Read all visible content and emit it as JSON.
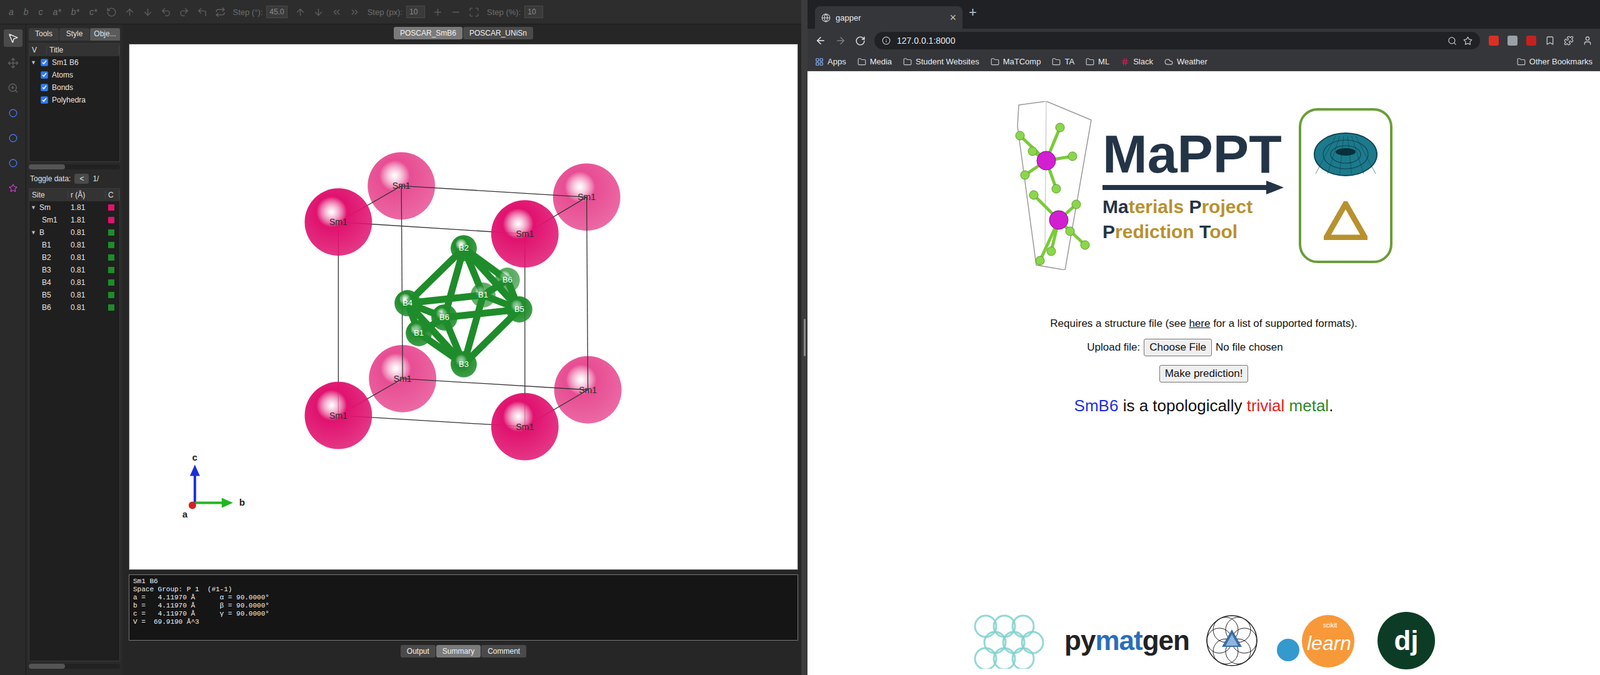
{
  "vesta": {
    "toolbar": {
      "axis_buttons": [
        "a",
        "b",
        "c",
        "a*",
        "b*",
        "c*"
      ],
      "fields": [
        {
          "label": "Step (°):",
          "value": "45.0"
        },
        {
          "label": "Step (px):",
          "value": "10"
        },
        {
          "label": "Step (%):",
          "value": "10"
        }
      ]
    },
    "side_tabs": [
      {
        "label": "Tools",
        "selected": false
      },
      {
        "label": "Style",
        "selected": false
      },
      {
        "label": "Obje...",
        "selected": true
      }
    ],
    "tree": {
      "columns": [
        "V",
        "Title"
      ],
      "items": [
        {
          "label": "Sm1 B6",
          "checked": true,
          "expanded": true,
          "toggle": "▼",
          "children": [
            {
              "label": "Atoms",
              "checked": true
            },
            {
              "label": "Bonds",
              "checked": true
            },
            {
              "label": "Polyhedra",
              "checked": true
            }
          ]
        }
      ]
    },
    "toggle": {
      "label": "Toggle data:",
      "prev": "<",
      "page": "1/"
    },
    "sites": {
      "columns": [
        "Site",
        "r (Å)",
        "C"
      ],
      "groups": [
        {
          "label": "Sm",
          "radius": "1.81",
          "color": "#e0126f",
          "expanded": true,
          "toggle": "▼",
          "rows": [
            {
              "label": "Sm1",
              "radius": "1.81",
              "color": "#e0126f"
            }
          ]
        },
        {
          "label": "B",
          "radius": "0.81",
          "color": "#1e8c2a",
          "expanded": true,
          "toggle": "▼",
          "rows": [
            {
              "label": "B1",
              "radius": "0.81",
              "color": "#1e8c2a"
            },
            {
              "label": "B2",
              "radius": "0.81",
              "color": "#1e8c2a"
            },
            {
              "label": "B3",
              "radius": "0.81",
              "color": "#1e8c2a"
            },
            {
              "label": "B4",
              "radius": "0.81",
              "color": "#1e8c2a"
            },
            {
              "label": "B5",
              "radius": "0.81",
              "color": "#1e8c2a"
            },
            {
              "label": "B6",
              "radius": "0.81",
              "color": "#1e8c2a"
            }
          ]
        }
      ]
    },
    "file_tabs": [
      {
        "label": "POSCAR_SmB6",
        "selected": true
      },
      {
        "label": "POSCAR_UNiSn",
        "selected": false
      }
    ],
    "structure": {
      "atoms": [
        {
          "label": "Sm1",
          "element": "Sm"
        },
        {
          "label": "Sm1",
          "element": "Sm"
        },
        {
          "label": "Sm1",
          "element": "Sm"
        },
        {
          "label": "Sm1",
          "element": "Sm"
        },
        {
          "label": "Sm1",
          "element": "Sm"
        },
        {
          "label": "Sm1",
          "element": "Sm"
        },
        {
          "label": "Sm1",
          "element": "Sm"
        },
        {
          "label": "Sm1",
          "element": "Sm"
        },
        {
          "label": "B6",
          "element": "B"
        },
        {
          "label": "B1",
          "element": "B"
        },
        {
          "label": "B2",
          "element": "B"
        },
        {
          "label": "B4",
          "element": "B"
        },
        {
          "label": "B5",
          "element": "B"
        },
        {
          "label": "B6",
          "element": "B"
        },
        {
          "label": "B1",
          "element": "B"
        },
        {
          "label": "B3",
          "element": "B"
        }
      ],
      "axes": [
        {
          "label": "a",
          "color": "#d62020"
        },
        {
          "label": "b",
          "color": "#22b522"
        },
        {
          "label": "c",
          "color": "#1b2fd6"
        }
      ]
    },
    "summary": [
      "Sm1 B6",
      "Space Group: P 1  (#1-1)",
      "a =   4.11970 Å      α = 90.0000°",
      "b =   4.11970 Å      β = 90.0000°",
      "c =   4.11970 Å      γ = 90.0000°",
      "V =  69.9190 Å^3"
    ],
    "output_tabs": [
      {
        "label": "Output",
        "selected": false
      },
      {
        "label": "Summary",
        "selected": true
      },
      {
        "label": "Comment",
        "selected": false
      }
    ]
  },
  "browser": {
    "tab": {
      "title": "gapper",
      "close": "×",
      "new": "+"
    },
    "url": "127.0.0.1:8000",
    "bookmarks": [
      {
        "label": "Apps",
        "kind": "apps"
      },
      {
        "label": "Media",
        "kind": "folder"
      },
      {
        "label": "Student Websites",
        "kind": "folder"
      },
      {
        "label": "MaTComp",
        "kind": "folder"
      },
      {
        "label": "TA",
        "kind": "folder"
      },
      {
        "label": "ML",
        "kind": "folder"
      },
      {
        "label": "Slack",
        "kind": "slack"
      },
      {
        "label": "Weather",
        "kind": "weather"
      }
    ],
    "other_bookmarks": "Other Bookmarks",
    "page": {
      "logo": {
        "title": "MaPPT",
        "subtitle": [
          [
            {
              "text": "Ma",
              "color": "#243447"
            },
            {
              "text": "terials ",
              "color": "#b8912f"
            },
            {
              "text": "P",
              "color": "#243447"
            },
            {
              "text": "roject",
              "color": "#b8912f"
            }
          ],
          [
            {
              "text": "P",
              "color": "#243447"
            },
            {
              "text": "rediction ",
              "color": "#b8912f"
            },
            {
              "text": "T",
              "color": "#243447"
            },
            {
              "text": "ool",
              "color": "#b8912f"
            }
          ]
        ]
      },
      "requires": {
        "before": "Requires a structure file (see ",
        "link": "here",
        "after": " for a list of supported formats)."
      },
      "upload": {
        "label": "Upload file:",
        "button": "Choose File",
        "status": "No file chosen"
      },
      "submit": "Make prediction!",
      "result": [
        {
          "text": "SmB6",
          "color": "#2030e0"
        },
        {
          "text": " is a topologically ",
          "color": "#111111"
        },
        {
          "text": "trivial",
          "color": "#e8201c"
        },
        {
          "text": " ",
          "color": "#111111"
        },
        {
          "text": "metal",
          "color": "#2a8a2a"
        },
        {
          "text": ".",
          "color": "#111111"
        }
      ],
      "footer": {
        "pymatgen": [
          {
            "text": "py",
            "color": "#222222"
          },
          {
            "text": "mat",
            "color": "#2a6ebb"
          },
          {
            "text": "gen",
            "color": "#222222"
          }
        ],
        "scikit": "scikit",
        "learn": "learn",
        "django": "dj"
      }
    }
  }
}
